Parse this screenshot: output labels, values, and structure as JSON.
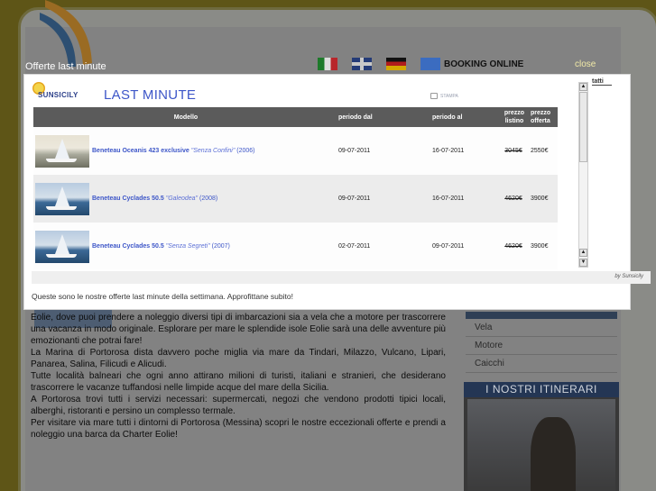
{
  "overlay": {
    "title": "Offerte last minute",
    "close_label": "close"
  },
  "header": {
    "booking_label": "BOOKING ONLINE",
    "nav_partial": "tatti"
  },
  "flags": [
    "flag-italy-icon",
    "flag-uk-icon",
    "flag-germany-icon",
    "flag-eu-icon"
  ],
  "modal": {
    "brand_name": "SUNSICILY",
    "title": "LAST MINUTE",
    "print_label": "STAMPA",
    "columns": {
      "model": "Modello",
      "from": "periodo dal",
      "to": "periodo al",
      "list_price": "prezzo listino",
      "offer_price": "prezzo offerta"
    },
    "rows": [
      {
        "model": "Beneteau Oceanis 423 exclusive",
        "name": "\"Senza Confini\"",
        "year": "(2006)",
        "from": "09-07-2011",
        "to": "16-07-2011",
        "list_price": "3045€",
        "offer_price": "2550€"
      },
      {
        "model": "Beneteau Cyclades 50.5",
        "name": "\"Galeodea\"",
        "year": "(2008)",
        "from": "09-07-2011",
        "to": "16-07-2011",
        "list_price": "4620€",
        "offer_price": "3900€"
      },
      {
        "model": "Beneteau Cyclades 50.5",
        "name": "\"Senza Segreti\"",
        "year": "(2007)",
        "from": "02-07-2011",
        "to": "09-07-2011",
        "list_price": "4620€",
        "offer_price": "3900€"
      }
    ],
    "credit": "by Sunsicily",
    "caption": "Queste sono le nostre offerte last minute della settimana. Approfittane subito!"
  },
  "background": {
    "paragraphs": [
      "Eolie, dove puoi prendere a noleggio diversi tipi di imbarcazioni sia a vela che a motore per trascorrere una vacanza in modo originale. Esplorare per mare le splendide isole Eolie sarà una delle avventure più emozionanti che potrai fare!",
      "La Marina di Portorosa dista davvero poche miglia via mare da Tindari, Milazzo, Vulcano, Lipari, Panarea, Salina, Filicudi e Alicudi.",
      "Tutte località balneari che ogni anno attirano milioni di turisti, italiani e stranieri, che desiderano trascorrere le vacanze tuffandosi nelle limpide acque del mare della Sicilia.",
      "A Portorosa trovi tutti i servizi necessari: supermercati, negozi che vendono prodotti tipici locali, alberghi, ristoranti e persino un complesso termale.",
      "Per visitare via mare tutti i dintorni di Portorosa (Messina) scopri le nostre eccezionali offerte e prendi a noleggio una barca da Charter Eolie!"
    ],
    "side_menu": [
      "Vela",
      "Motore",
      "Caicchi"
    ],
    "itinerari_title": "I NOSTRI ITINERARI"
  }
}
